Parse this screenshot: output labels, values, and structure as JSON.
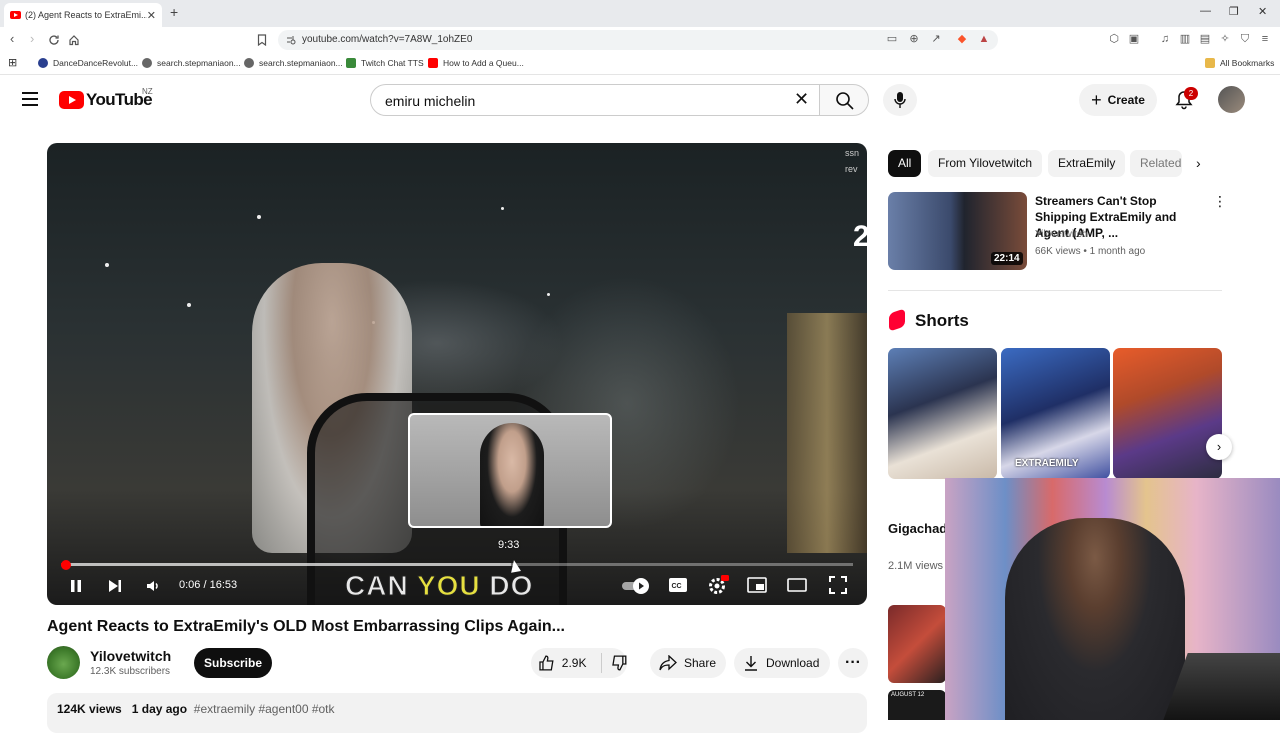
{
  "browser": {
    "tab_title": "(2) Agent Reacts to ExtraEmi...",
    "url": "youtube.com/watch?v=7A8W_1ohZE0",
    "bookmarks": [
      "DanceDanceRevolut...",
      "search.stepmaniaon...",
      "search.stepmaniaon...",
      "Twitch Chat TTS",
      "How to Add a Queu..."
    ],
    "all_bookmarks": "All Bookmarks",
    "new_tab": "+",
    "close_tab": "✕",
    "win_min": "—",
    "win_max": "❐",
    "win_close": "✕"
  },
  "header": {
    "logo": "YouTube",
    "country": "NZ",
    "search_value": "emiru michelin",
    "clear": "✕",
    "create_label": "Create",
    "create_plus": "+",
    "notifications": "2"
  },
  "player": {
    "caption_pre": "CAN ",
    "caption_hl": "YOU",
    "caption_post": " DO",
    "preview_time": "9:33",
    "time": "0:06 / 16:53",
    "progress_fraction": 0.006,
    "overlay_text": [
      "ssn",
      "rev"
    ],
    "overlay_num": "2"
  },
  "video": {
    "title": "Agent Reacts to ExtraEmily's OLD Most Embarrassing Clips Again...",
    "channel": "Yilovetwitch",
    "subscribers": "12.3K subscribers",
    "subscribe": "Subscribe",
    "likes": "2.9K",
    "share": "Share",
    "download": "Download",
    "views": "124K views",
    "age": "1 day ago",
    "tags": "#extraemily #agent00 #otk"
  },
  "sidebar": {
    "chips": [
      "All",
      "From Yilovetwitch",
      "ExtraEmily",
      "Related"
    ],
    "recommended": {
      "title": "Streamers Can't Stop Shipping ExtraEmily and Agent (AMP, ...",
      "channel": "Yilovetwitch",
      "meta": "66K views • 1 month ago",
      "duration": "22:14"
    },
    "shorts_title": "Shorts",
    "short1_title": "Gigachad Emily drin",
    "short1_views": "2.1M views",
    "short_card2_text": "EXTRAEMILY",
    "small2_text": "AUGUST 12"
  },
  "colors": {
    "accent": "#ff0000",
    "brand_text": "#0f0f0f",
    "chip_bg": "#f2f2f2"
  }
}
